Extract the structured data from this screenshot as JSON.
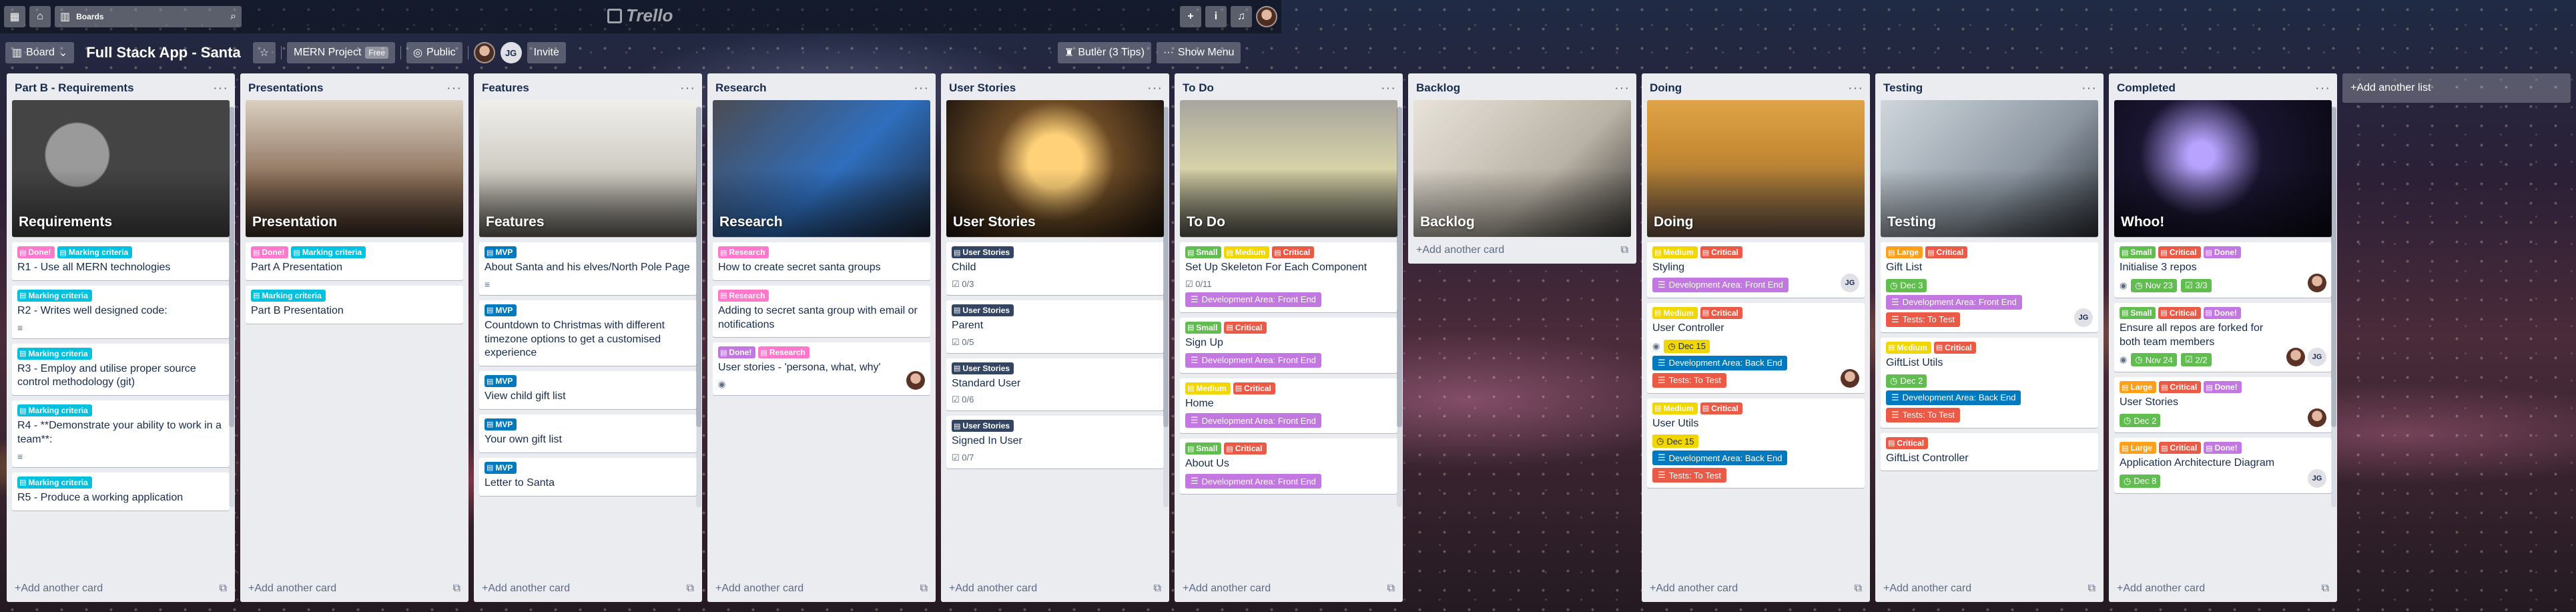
{
  "topbar": {
    "boards_label": "Boards",
    "logo": "Trello",
    "add_icon": "+",
    "info_icon": "i",
    "bell_icon": "🔔"
  },
  "board": {
    "switcher_label": "Board",
    "title": "Full Stack App - Santa",
    "team": "MERN Project",
    "team_tier": "Free",
    "visibility": "Public",
    "member_initials": "JG",
    "invite": "Invite",
    "butler": "Butler (3 Tips)",
    "menu": "Show Menu"
  },
  "colors": {
    "green": "#61bd4f",
    "yellow": "#f2d600",
    "orange": "#ff9f1a",
    "red": "#eb5a46",
    "purple": "#c377e0",
    "blue": "#0079bf",
    "sky": "#00c2e0",
    "pink": "#ff78cb",
    "black": "#344563"
  },
  "common": {
    "add_card": "Add another card",
    "add_list": "Add another list",
    "list_menu": "···"
  },
  "lists": [
    {
      "title": "Part B - Requirements",
      "cover": "Requirements",
      "cards": [
        {
          "labels": [
            [
              "Done!",
              "pink"
            ],
            [
              "Marking criteria",
              "sky"
            ]
          ],
          "title": "R1 - Use all MERN technologies"
        },
        {
          "labels": [
            [
              "Marking criteria",
              "sky"
            ]
          ],
          "title": "R2 - Writes well designed code:",
          "desc": true
        },
        {
          "labels": [
            [
              "Marking criteria",
              "sky"
            ]
          ],
          "title": "R3 - Employ and utilise proper source control methodology (git)"
        },
        {
          "labels": [
            [
              "Marking criteria",
              "sky"
            ]
          ],
          "title": "R4 - **Demonstrate your ability to work in a team**:",
          "desc": true
        },
        {
          "labels": [
            [
              "Marking criteria",
              "sky"
            ]
          ],
          "title": "R5 - Produce a working application"
        }
      ]
    },
    {
      "title": "Presentations",
      "cover": "Presentation",
      "cards": [
        {
          "labels": [
            [
              "Done!",
              "pink"
            ],
            [
              "Marking criteria",
              "sky"
            ]
          ],
          "title": "Part A Presentation"
        },
        {
          "labels": [
            [
              "Marking criteria",
              "sky"
            ]
          ],
          "title": "Part B Presentation"
        }
      ]
    },
    {
      "title": "Features",
      "cover": "Features",
      "cards": [
        {
          "labels": [
            [
              "MVP",
              "blue"
            ]
          ],
          "title": "About Santa and his elves/North Pole Page",
          "desc": true
        },
        {
          "labels": [
            [
              "MVP",
              "blue"
            ]
          ],
          "title": "Countdown to Christmas with different timezone options to get a customised experience"
        },
        {
          "labels": [
            [
              "MVP",
              "blue"
            ]
          ],
          "title": "View child gift list"
        },
        {
          "labels": [
            [
              "MVP",
              "blue"
            ]
          ],
          "title": "Your own gift list"
        },
        {
          "labels": [
            [
              "MVP",
              "blue"
            ]
          ],
          "title": "Letter to Santa"
        }
      ]
    },
    {
      "title": "Research",
      "cover": "Research",
      "cards": [
        {
          "labels": [
            [
              "Research",
              "pink"
            ]
          ],
          "title": "How to create secret santa groups"
        },
        {
          "labels": [
            [
              "Research",
              "pink"
            ]
          ],
          "title": "Adding to secret santa group with email or notifications"
        },
        {
          "labels": [
            [
              "Done!",
              "purple"
            ],
            [
              "Research",
              "pink"
            ]
          ],
          "title": "User stories - 'persona, what, why'",
          "watch": true,
          "avatar": true
        }
      ]
    },
    {
      "title": "User Stories",
      "cover": "User Stories",
      "cards": [
        {
          "labels": [
            [
              "User Stories",
              "black"
            ]
          ],
          "title": "Child",
          "check": "0/3"
        },
        {
          "labels": [
            [
              "User Stories",
              "black"
            ]
          ],
          "title": "Parent",
          "check": "0/5"
        },
        {
          "labels": [
            [
              "User Stories",
              "black"
            ]
          ],
          "title": "Standard User",
          "check": "0/6"
        },
        {
          "labels": [
            [
              "User Stories",
              "black"
            ]
          ],
          "title": "Signed In User",
          "check": "0/7"
        }
      ]
    },
    {
      "title": "To Do",
      "cover": "To Do",
      "cards": [
        {
          "labels": [
            [
              "Small",
              "green"
            ],
            [
              "Medium",
              "yellow"
            ],
            [
              "Critical",
              "red"
            ]
          ],
          "title": "Set Up Skeleton For Each Component",
          "check": "0/11",
          "fields": [
            [
              "Development Area: Front End",
              "purple"
            ]
          ]
        },
        {
          "labels": [
            [
              "Small",
              "green"
            ],
            [
              "Critical",
              "red"
            ]
          ],
          "title": "Sign Up",
          "fields": [
            [
              "Development Area: Front End",
              "purple"
            ]
          ]
        },
        {
          "labels": [
            [
              "Medium",
              "yellow"
            ],
            [
              "Critical",
              "red"
            ]
          ],
          "title": "Home",
          "fields": [
            [
              "Development Area: Front End",
              "purple"
            ]
          ]
        },
        {
          "labels": [
            [
              "Small",
              "green"
            ],
            [
              "Critical",
              "red"
            ]
          ],
          "title": "About Us",
          "fields": [
            [
              "Development Area: Front End",
              "purple"
            ]
          ]
        }
      ]
    },
    {
      "title": "Backlog",
      "cover": "Backlog",
      "cards": []
    },
    {
      "title": "Doing",
      "cover": "Doing",
      "cards": [
        {
          "labels": [
            [
              "Medium",
              "yellow"
            ],
            [
              "Critical",
              "red"
            ]
          ],
          "title": "Styling",
          "fields": [
            [
              "Development Area: Front End",
              "purple"
            ]
          ],
          "jg": true
        },
        {
          "labels": [
            [
              "Medium",
              "yellow"
            ],
            [
              "Critical",
              "red"
            ]
          ],
          "title": "User Controller",
          "watch": true,
          "due": [
            "Dec 15",
            "yellow"
          ],
          "fields": [
            [
              "Development Area: Back End",
              "blue"
            ],
            [
              "Tests: To Test",
              "red"
            ]
          ],
          "avatar": true
        },
        {
          "labels": [
            [
              "Medium",
              "yellow"
            ],
            [
              "Critical",
              "red"
            ]
          ],
          "title": "User Utils",
          "due": [
            "Dec 15",
            "yellow"
          ],
          "fields": [
            [
              "Development Area: Back End",
              "blue"
            ],
            [
              "Tests: To Test",
              "red"
            ]
          ]
        }
      ]
    },
    {
      "title": "Testing",
      "cover": "Testing",
      "cards": [
        {
          "labels": [
            [
              "Large",
              "orange"
            ],
            [
              "Critical",
              "red"
            ]
          ],
          "title": "Gift List",
          "due": [
            "Dec 3",
            "green"
          ],
          "fields": [
            [
              "Development Area: Front End",
              "purple"
            ],
            [
              "Tests: To Test",
              "red"
            ]
          ],
          "jg": true
        },
        {
          "labels": [
            [
              "Medium",
              "yellow"
            ],
            [
              "Critical",
              "red"
            ]
          ],
          "title": "GiftList Utils",
          "due": [
            "Dec 2",
            "green"
          ],
          "fields": [
            [
              "Development Area: Back End",
              "blue"
            ],
            [
              "Tests: To Test",
              "red"
            ]
          ]
        },
        {
          "labels": [
            [
              "Critical",
              "red"
            ]
          ],
          "title": "GiftList Controller"
        }
      ]
    },
    {
      "title": "Completed",
      "cover": "Whoo!",
      "cards": [
        {
          "labels": [
            [
              "Small",
              "green"
            ],
            [
              "Critical",
              "red"
            ],
            [
              "Done!",
              "purple"
            ]
          ],
          "title": "Initialise 3 repos",
          "watch": true,
          "due": [
            "Nov 23",
            "green"
          ],
          "check_done": "3/3",
          "avatar": true
        },
        {
          "labels": [
            [
              "Small",
              "green"
            ],
            [
              "Critical",
              "red"
            ],
            [
              "Done!",
              "purple"
            ]
          ],
          "title": "Ensure all repos are forked for both team members",
          "watch": true,
          "due": [
            "Nov 24",
            "green"
          ],
          "check_done": "2/2",
          "avatar_jg": true
        },
        {
          "labels": [
            [
              "Large",
              "orange"
            ],
            [
              "Critical",
              "red"
            ],
            [
              "Done!",
              "purple"
            ]
          ],
          "title": "User Stories",
          "due": [
            "Dec 2",
            "green"
          ],
          "avatar": true
        },
        {
          "labels": [
            [
              "Large",
              "orange"
            ],
            [
              "Critical",
              "red"
            ],
            [
              "Done!",
              "purple"
            ]
          ],
          "title": "Application Architecture Diagram",
          "due": [
            "Dec 8",
            "green"
          ],
          "jg": true
        }
      ]
    }
  ]
}
